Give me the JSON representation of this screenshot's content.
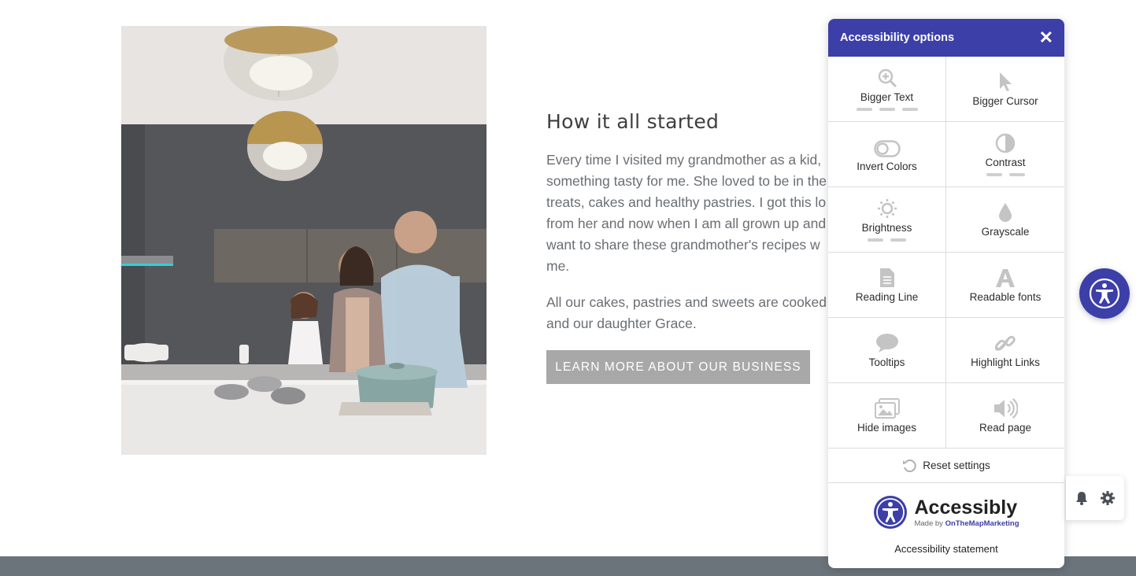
{
  "section": {
    "title": "How it all started",
    "paragraph1_lines": [
      "Every time I visited my grandmother as a kid,",
      "something tasty for me. She loved to be in the",
      "treats, cakes and healthy pastries. I got this lo",
      "from her and now when I am all grown up and",
      "want to share these grandmother's recipes w",
      "me."
    ],
    "paragraph2_lines": [
      "All our cakes, pastries and sweets are cooked",
      "and our daughter Grace."
    ],
    "cta_label": "LEARN MORE ABOUT OUR BUSINESS"
  },
  "accessibility_panel": {
    "title": "Accessibility options",
    "close_icon": "close-icon",
    "tiles": [
      {
        "label": "Bigger Text",
        "icon": "zoom-in-icon",
        "levels": 3
      },
      {
        "label": "Bigger Cursor",
        "icon": "cursor-icon",
        "levels": 0
      },
      {
        "label": "Invert Colors",
        "icon": "toggle-icon",
        "levels": 0
      },
      {
        "label": "Contrast",
        "icon": "contrast-icon",
        "levels": 2
      },
      {
        "label": "Brightness",
        "icon": "sun-icon",
        "levels": 2
      },
      {
        "label": "Grayscale",
        "icon": "drop-icon",
        "levels": 0
      },
      {
        "label": "Reading Line",
        "icon": "document-icon",
        "levels": 0
      },
      {
        "label": "Readable fonts",
        "icon": "font-icon",
        "levels": 0
      },
      {
        "label": "Tooltips",
        "icon": "speech-bubble-icon",
        "levels": 0
      },
      {
        "label": "Highlight Links",
        "icon": "link-icon",
        "levels": 0
      },
      {
        "label": "Hide images",
        "icon": "images-icon",
        "levels": 0
      },
      {
        "label": "Read page",
        "icon": "speaker-icon",
        "levels": 0
      }
    ],
    "reset_label": "Reset settings",
    "brand_name": "Accessibly",
    "brand_made_by": "Made by",
    "brand_company": "OnTheMapMarketing",
    "statement_label": "Accessibility statement"
  },
  "colors": {
    "panel_accent": "#3c3fa7",
    "cta_background": "#a8a8a8",
    "footer_band": "#6c747b",
    "icon_gray": "#c4c4c4"
  },
  "widgets": {
    "fab_icon": "accessibility-person-icon",
    "bell_icon": "bell-icon",
    "gear_icon": "gear-icon"
  }
}
